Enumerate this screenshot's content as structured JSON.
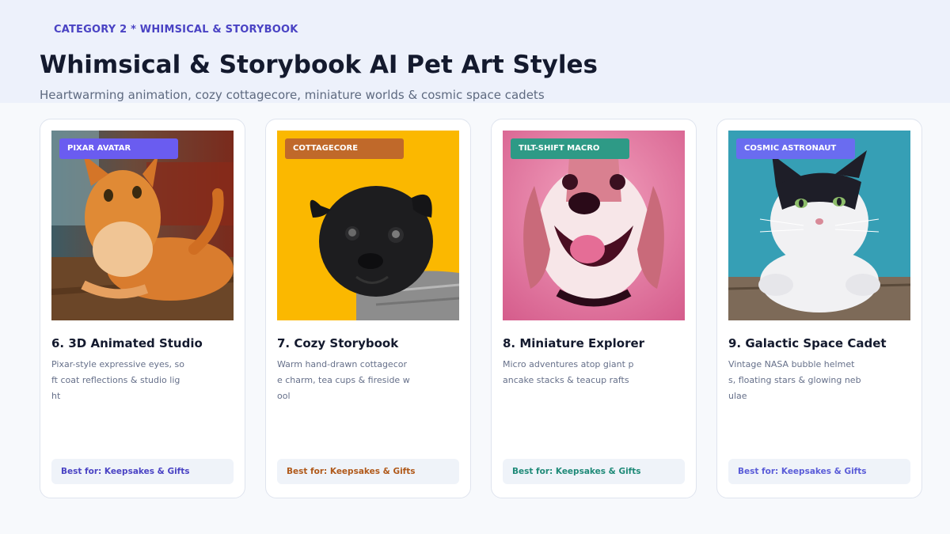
{
  "header": {
    "eyebrow": "CATEGORY 2 * WHIMSICAL & STORYBOOK",
    "title": "Whimsical & Storybook AI Pet Art Styles",
    "subtitle": "Heartwarming animation, cozy cottagecore, miniature worlds & cosmic space cadets"
  },
  "cards": [
    {
      "tag": "PIXAR AVATAR",
      "title": "6. 3D Animated Studio",
      "description": "Pixar-style expressive eyes, soft coat reflections & studio light",
      "best_for": "Best for: Keepsakes & Gifts",
      "accent": "#6a5cf0",
      "best_for_color": "#4a43c4",
      "image": "orange cat lounging on wooden floor"
    },
    {
      "tag": "COTTAGECORE",
      "title": "7. Cozy Storybook",
      "description": "Warm hand-drawn cottagecore charm, tea cups & fireside wool",
      "best_for": "Best for: Keepsakes & Gifts",
      "accent": "#c0692a",
      "best_for_color": "#b0591a",
      "image": "black pug in knit sweater on yellow background"
    },
    {
      "tag": "TILT-SHIFT MACRO",
      "title": "8. Miniature Explorer",
      "description": "Micro adventures atop giant pancake stacks & teacup rafts",
      "best_for": "Best for: Keepsakes & Gifts",
      "accent": "#2e9a86",
      "best_for_color": "#1f8a78",
      "image": "smiling beagle with pink tint"
    },
    {
      "tag": "COSMIC ASTRONAUT",
      "title": "9. Galactic Space Cadet",
      "description": "Vintage NASA bubble helmets, floating stars & glowing nebulae",
      "best_for": "Best for: Keepsakes & Gifts",
      "accent": "#6a6cf0",
      "best_for_color": "#5a5cd8",
      "image": "black and white cat peeking over wall on teal background"
    }
  ]
}
